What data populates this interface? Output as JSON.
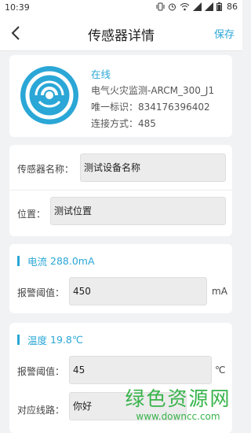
{
  "status_bar": {
    "time": "10:39",
    "battery": "86"
  },
  "navbar": {
    "title": "传感器详情",
    "save_label": "保存",
    "back_icon": "chevron-left-icon"
  },
  "device": {
    "status": "在线",
    "model": "电气火灾监测-ARCM_300_J1",
    "uid_line": "唯一标识：834176396402",
    "connect_line": "连接方式：485"
  },
  "form": {
    "name_label": "传感器名称：",
    "name_value": "测试设备名称",
    "location_label": "位置：",
    "location_value": "测试位置"
  },
  "current": {
    "title": "电流",
    "reading": "288.0mA",
    "alarm_label": "报警阈值：",
    "alarm_value": "450",
    "unit": "mA"
  },
  "temperature": {
    "title": "温度",
    "reading": "19.8℃",
    "alarm_label": "报警阈值：",
    "alarm_value": "45",
    "unit": "℃",
    "line_label": "对应线路：",
    "line_value": "你好"
  },
  "watermark": {
    "main": "绿色资源网",
    "sub": "www.downcc.com"
  },
  "colors": {
    "accent": "#2aa7d6",
    "watermark": "#37b34a",
    "background": "#f1f2f4"
  }
}
